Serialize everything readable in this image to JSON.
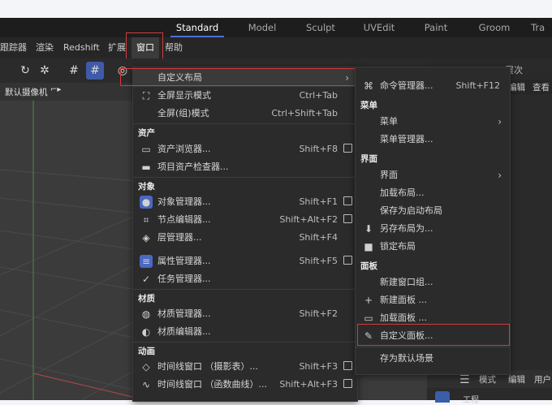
{
  "tabs": [
    {
      "label": "Standard",
      "active": true
    },
    {
      "label": "Model"
    },
    {
      "label": "Sculpt"
    },
    {
      "label": "UVEdit"
    },
    {
      "label": "Paint"
    },
    {
      "label": "Groom"
    },
    {
      "label": "Tra"
    }
  ],
  "menubar": [
    "跟踪器",
    "渲染",
    "Redshift",
    "扩展",
    "窗口",
    "帮助"
  ],
  "viewport": {
    "camera_label": "默认摄像机"
  },
  "rightpanel": {
    "top_label": "层次",
    "menu": [
      "编辑",
      "查看"
    ],
    "bottom_menu": [
      "模式",
      "编辑",
      "用户"
    ],
    "bottom_label": "工程"
  },
  "window_menu": {
    "items": [
      {
        "label": "自定义布局",
        "shortcut": "",
        "arrow": true
      },
      {
        "label": "全屏显示模式",
        "shortcut": "Ctrl+Tab",
        "icon": "fullscreen-icon"
      },
      {
        "label": "全屏(组)模式",
        "shortcut": "Ctrl+Shift+Tab"
      },
      {
        "section": "资产"
      },
      {
        "label": "资产浏览器...",
        "shortcut": "Shift+F8",
        "icon": "asset-browser-icon",
        "ext": true
      },
      {
        "label": "项目资产检查器...",
        "shortcut": "",
        "icon": "folder-icon"
      },
      {
        "section": "对象"
      },
      {
        "label": "对象管理器...",
        "shortcut": "Shift+F1",
        "icon": "object-manager-icon",
        "ext": true
      },
      {
        "label": "节点编辑器...",
        "shortcut": "Shift+Alt+F2",
        "icon": "node-editor-icon",
        "ext": true
      },
      {
        "label": "层管理器...",
        "shortcut": "Shift+F4",
        "icon": "layers-icon"
      },
      {
        "label": "属性管理器...",
        "shortcut": "Shift+F5",
        "icon": "attribute-manager-icon",
        "ext": true
      },
      {
        "label": "任务管理器...",
        "shortcut": "",
        "icon": "check-circle-icon"
      },
      {
        "section": "材质"
      },
      {
        "label": "材质管理器...",
        "shortcut": "Shift+F2",
        "icon": "material-manager-icon"
      },
      {
        "label": "材质编辑器...",
        "shortcut": "",
        "icon": "material-editor-icon"
      },
      {
        "section": "动画"
      },
      {
        "label": "时间线窗口 （摄影表）...",
        "shortcut": "Shift+F3",
        "icon": "diamond-icon",
        "ext": true
      },
      {
        "label": "时间线窗口 （函数曲线）...",
        "shortcut": "Shift+Alt+F3",
        "icon": "curve-icon",
        "ext": true
      }
    ]
  },
  "submenu": {
    "items": [
      {
        "label": "命令管理器...",
        "shortcut": "Shift+F12",
        "icon": "command-icon"
      },
      {
        "section": "菜单"
      },
      {
        "label": "菜单",
        "arrow": true
      },
      {
        "label": "菜单管理器..."
      },
      {
        "section": "界面"
      },
      {
        "label": "界面",
        "arrow": true
      },
      {
        "label": "加载布局..."
      },
      {
        "label": "保存为启动布局"
      },
      {
        "label": "另存布局为...",
        "icon": "download-icon"
      },
      {
        "label": "锁定布局",
        "icon": "lock-icon"
      },
      {
        "section": "面板"
      },
      {
        "label": "新建窗口组..."
      },
      {
        "label": "新建面板 ...",
        "icon": "plus-icon"
      },
      {
        "label": "加载面板 ...",
        "icon": "folder-icon"
      },
      {
        "label": "自定义面板...",
        "icon": "pencil-icon"
      },
      {
        "label": "存为默认场景"
      }
    ]
  }
}
